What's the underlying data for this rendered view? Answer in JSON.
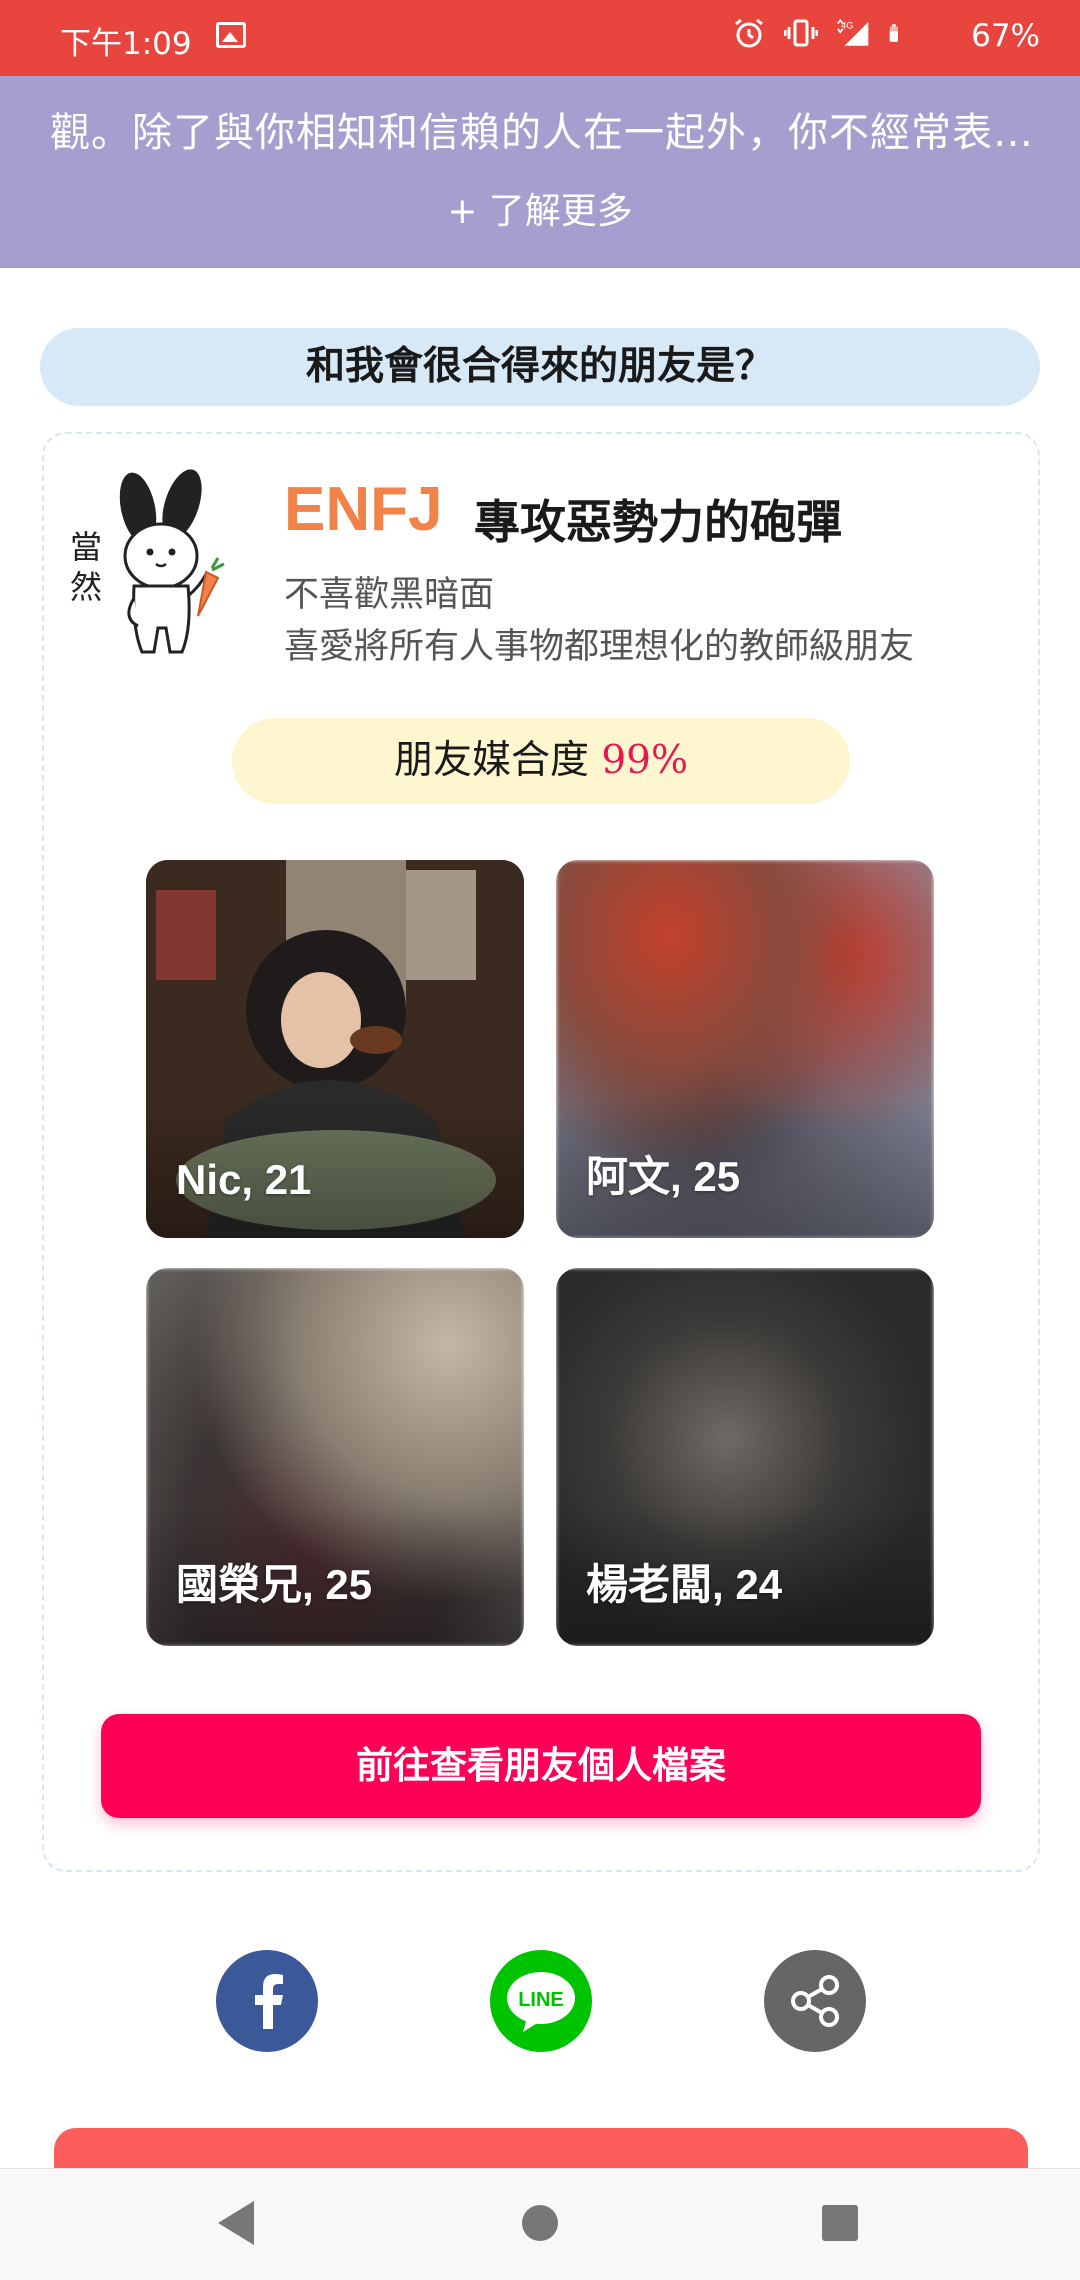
{
  "status_bar": {
    "time": "下午1:09",
    "battery": "67%",
    "network": "4G",
    "background_color": "#e8453f"
  },
  "banner": {
    "cut_text": "觀　知　自　　　　　　　　　　　　　　　",
    "text": "觀。除了與你相知和信賴的人在一起外，你不經常表…",
    "more_label": "+ 了解更多",
    "background_color": "#a59fd0"
  },
  "section_title": "和我會很合得來的朋友是？",
  "personality": {
    "mascot_caption": [
      "當",
      "然"
    ],
    "code": "ENFJ",
    "title": "專攻惡勢力的砲彈",
    "desc_line1": "不喜歡黑暗面",
    "desc_line2": "喜愛將所有人事物都理想化的教師級朋友",
    "code_color": "#f0824a"
  },
  "match": {
    "label": "朋友媒合度",
    "value": "99%"
  },
  "friends": [
    {
      "label": "Nic, 21",
      "blurred": false
    },
    {
      "label": "阿文, 25",
      "blurred": true
    },
    {
      "label": "國榮兄, 25",
      "blurred": true
    },
    {
      "label": "楊老闆, 24",
      "blurred": true
    }
  ],
  "cta_label": "前往查看朋友個人檔案",
  "cta_color": "#ff0057",
  "share": {
    "facebook_icon": "facebook-icon",
    "line_label": "LINE",
    "share_icon": "share-icon"
  },
  "nav": {
    "back_icon": "back-icon",
    "home_icon": "home-icon",
    "recents_icon": "recents-icon"
  }
}
